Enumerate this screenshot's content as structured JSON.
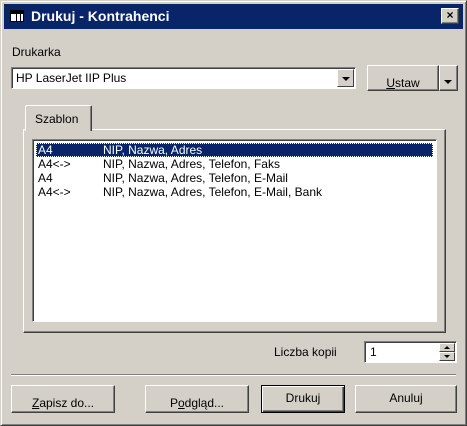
{
  "window": {
    "title": "Drukuj - Kontrahenci",
    "close_label": "×",
    "title_icon": "table-icon"
  },
  "printer": {
    "label": "Drukarka",
    "selected": "HP LaserJet IIP Plus",
    "setup_button": "Ustaw"
  },
  "tab": {
    "label": "Szablon"
  },
  "templates": [
    {
      "format": "A4",
      "fields": "NIP, Nazwa, Adres",
      "selected": true
    },
    {
      "format": "A4<->",
      "fields": "NIP, Nazwa, Adres, Telefon, Faks",
      "selected": false
    },
    {
      "format": "A4",
      "fields": "NIP, Nazwa, Adres, Telefon, E-Mail",
      "selected": false
    },
    {
      "format": "A4<->",
      "fields": "NIP, Nazwa, Adres, Telefon, E-Mail, Bank",
      "selected": false
    }
  ],
  "copies": {
    "label": "Liczba kopii",
    "value": "1"
  },
  "buttons": {
    "save": "Zapisz do...",
    "preview": "Podgląd...",
    "print": "Drukuj",
    "cancel": "Anuluj"
  },
  "colors": {
    "titlebar": "#0a246a",
    "face": "#d4d0c8",
    "selection": "#0a246a"
  }
}
